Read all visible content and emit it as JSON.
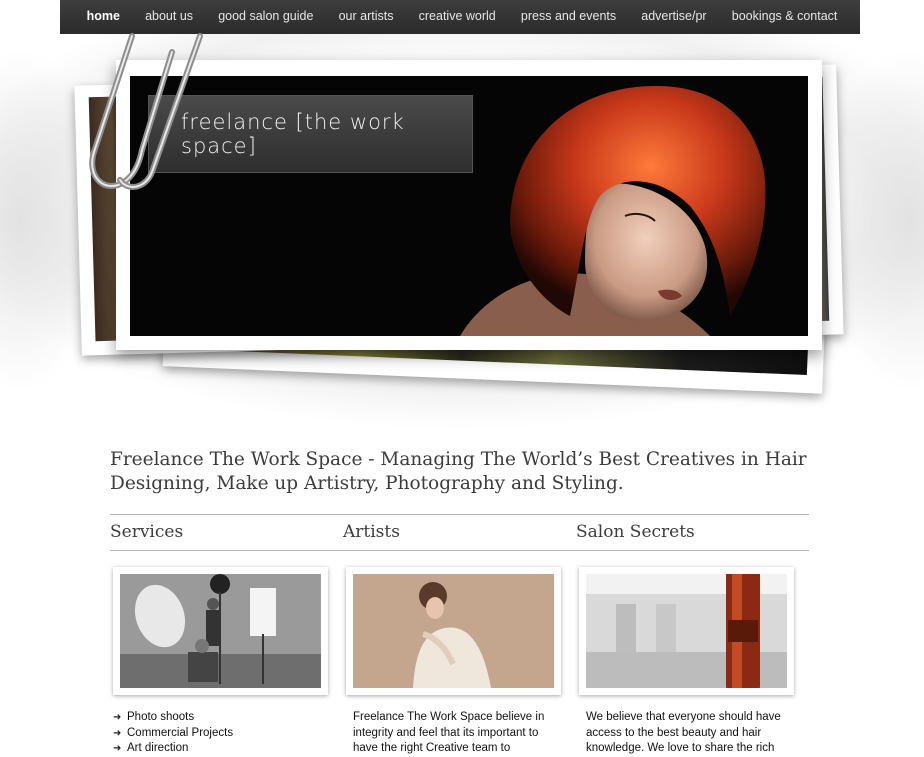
{
  "nav": {
    "items": [
      {
        "label": "home",
        "active": true
      },
      {
        "label": "about us"
      },
      {
        "label": "good salon guide"
      },
      {
        "label": "our artists"
      },
      {
        "label": "creative world"
      },
      {
        "label": "press and events"
      },
      {
        "label": "advertise/pr"
      },
      {
        "label": "bookings & contact"
      }
    ]
  },
  "hero": {
    "brand": "freelance [the work space]"
  },
  "main": {
    "headline": "Freelance The Work Space - Managing The World’s Best Creatives in Hair Designing, Make up Artistry, Photography and Styling.",
    "columns": {
      "services": {
        "title": "Services",
        "items": [
          "Photo shoots",
          "Commercial Projects",
          "Art direction"
        ]
      },
      "artists": {
        "title": "Artists",
        "text": "Freelance The Work Space believe in integrity and feel that its important to have the right Creative team to"
      },
      "salon": {
        "title": "Salon Secrets",
        "text": "We believe that everyone should have access to the best beauty and hair knowledge. We love to share the rich"
      }
    }
  }
}
